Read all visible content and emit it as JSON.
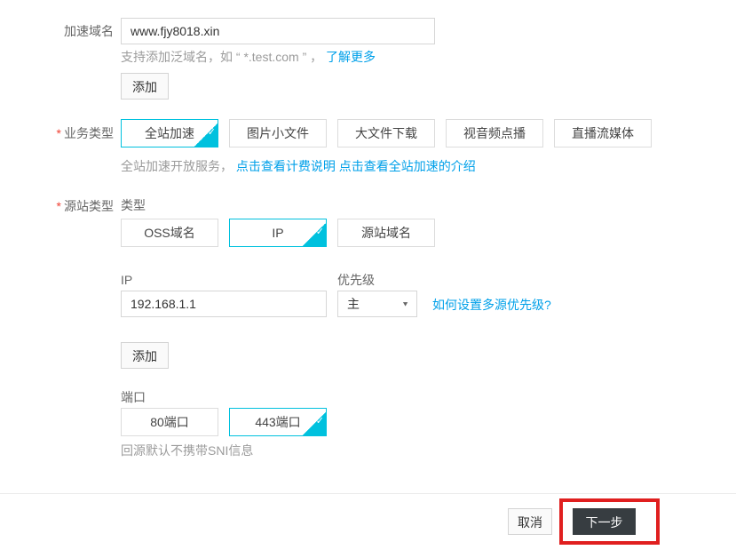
{
  "colors": {
    "cyan": "#00c1de",
    "link": "#00a0e9",
    "red": "#f04134",
    "annotation": "#e01f1f"
  },
  "icons": {
    "check": "✓",
    "caret_down": "▼"
  },
  "domain_section": {
    "label": "加速域名",
    "input_value": "www.fjy8018.xin",
    "help_text": "支持添加泛域名，如 “ *.test.com ” ，",
    "help_link": "了解更多",
    "add_button": "添加"
  },
  "business_type": {
    "required_mark": "*",
    "label": "业务类型",
    "options": [
      {
        "label": "全站加速",
        "selected": true
      },
      {
        "label": "图片小文件",
        "selected": false
      },
      {
        "label": "大文件下载",
        "selected": false
      },
      {
        "label": "视音频点播",
        "selected": false
      },
      {
        "label": "直播流媒体",
        "selected": false
      }
    ],
    "note_text": "全站加速开放服务，",
    "note_link_billing": "点击查看计费说明",
    "note_link_intro": "点击查看全站加速的介绍"
  },
  "origin_section": {
    "required_mark": "*",
    "label": "源站类型",
    "type_label": "类型",
    "type_options": [
      {
        "label": "OSS域名",
        "selected": false
      },
      {
        "label": "IP",
        "selected": true
      },
      {
        "label": "源站域名",
        "selected": false
      }
    ],
    "ip_label": "IP",
    "ip_value": "192.168.1.1",
    "priority_label": "优先级",
    "priority_value": "主",
    "priority_help_link": "如何设置多源优先级?",
    "add_button": "添加",
    "port_label": "端口",
    "port_options": [
      {
        "label": "80端口",
        "selected": false
      },
      {
        "label": "443端口",
        "selected": true
      }
    ],
    "port_note": "回源默认不携带SNI信息"
  },
  "footer": {
    "cancel_label": "取消",
    "next_label": "下一步"
  }
}
